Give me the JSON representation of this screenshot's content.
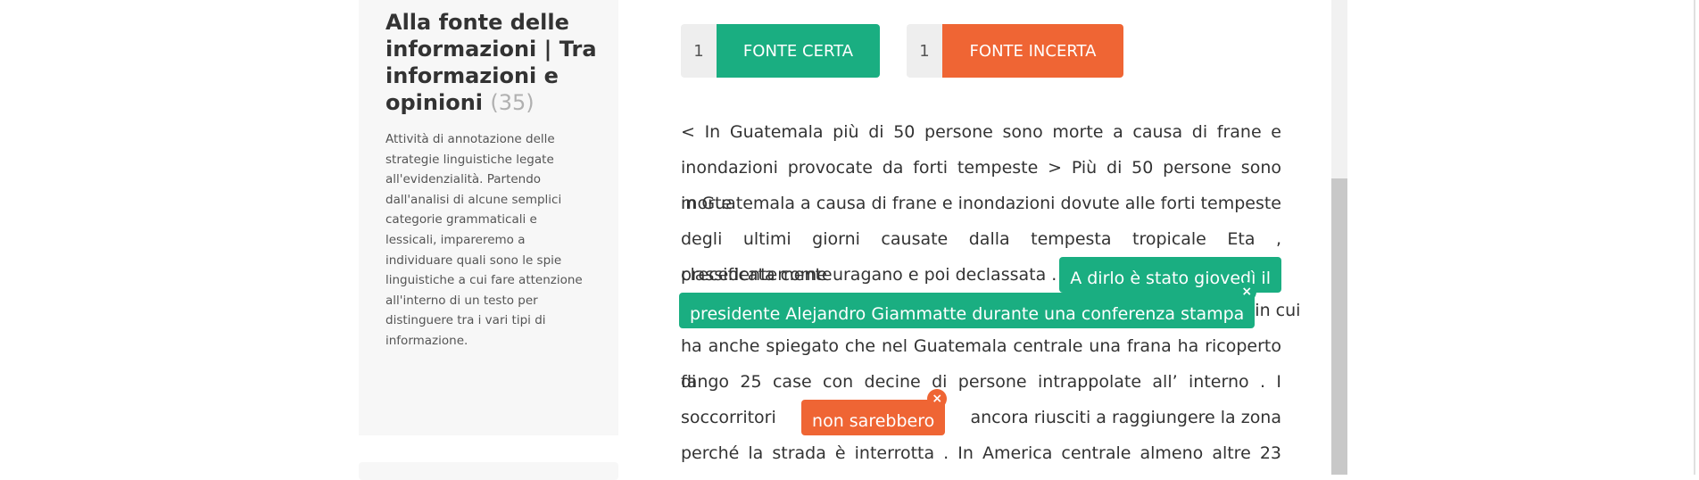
{
  "sidebar": {
    "title": "Alla fonte delle informazioni | Tra informazioni e opinioni",
    "count": "(35)",
    "description": "Attività di annotazione delle strategie linguistiche legate all'evidenzialità. Partendo dall'analisi di alcune semplici categorie grammaticali e lessicali, impareremo a individuare quali sono le spie linguistiche a cui fare attenzione all'interno di un testo per distinguere tra i vari tipi di informazione."
  },
  "buttons": {
    "certa": {
      "count": "1",
      "label": "FONTE CERTA",
      "color": "#1aae81"
    },
    "incerta": {
      "count": "1",
      "label": "FONTE INCERTA",
      "color": "#ef6534"
    }
  },
  "text": {
    "l1": "< In Guatemala più di 50 persone sono morte a causa di frane e",
    "l2": "inondazioni provocate da forti tempeste > Più di 50 persone sono morte",
    "l3": "in Guatemala a causa di frane e inondazioni dovute alle forti tempeste",
    "l4": "degli ultimi giorni causate dalla tempesta tropicale Eta , precedentemente",
    "l5_pre": "classificata come uragano e poi declassata .",
    "ann1_part1": "A dirlo è stato giovedì il",
    "ann1_part2": "presidente Alejandro Giammatte durante una conferenza stampa",
    "l6_post": "in cui",
    "l7": "ha anche spiegato che nel Guatemala centrale una frana ha ricoperto di",
    "l8": "fango 25 case con decine di persone intrappolate all’ interno . I",
    "l9_pre": "soccorritori",
    "ann2": "non sarebbero",
    "l9_post": "ancora riusciti a raggiungere la zona",
    "l10": "perché la strada è interrotta . In America centrale almeno altre 23"
  },
  "icons": {
    "remove": "×"
  }
}
